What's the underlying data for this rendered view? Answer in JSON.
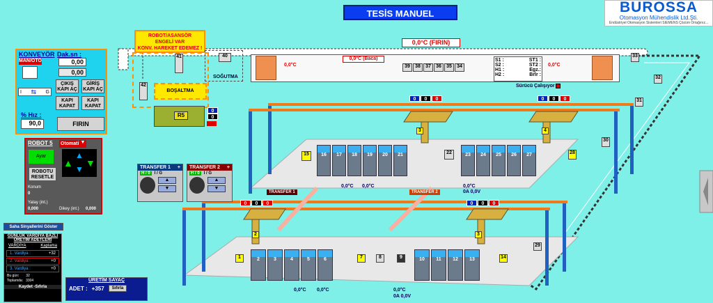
{
  "header": {
    "title": "TESİS MANUEL"
  },
  "logo": {
    "name": "BUROSSA",
    "subtitle": "Otomasyon Mühendislik Ltd.Şti.",
    "tagline": "Endüstriyel Otomasyon Sistemleri SIEMENS Çözüm Ortağınız..."
  },
  "konveyor": {
    "title": "KONVEYÖR",
    "mode_btn": "MAN/OTO",
    "dak_label": "Dak.sn :",
    "dak_val1": "0,00",
    "dak_val2": "0,00",
    "cikis_kapi_ac": "ÇIKIŞ KAPI AÇ",
    "giris_kapi_ac": "GİRİŞ KAPI AÇ",
    "kapi_kapat1": "KAPI KAPAT",
    "kapi_kapat2": "KAPI KAPAT",
    "speed_label": "% Hız :",
    "speed_val": "90,0",
    "firin_btn": "FIRIN",
    "dir_left": "I",
    "dir_right": "G"
  },
  "robot5": {
    "title": "ROBOT 5",
    "mode": "Otomatik",
    "status": "Ayar",
    "reset_btn": "ROBOTU RESETLE",
    "konum_label": "Konum",
    "konum_val": "0",
    "yatay_label": "Yatay (int.)",
    "yatay_val": "0,000",
    "dikey_label": "Dikey (int.)",
    "dikey_val": "0,000"
  },
  "saha_btn": "Saha Sinyallerini Göster",
  "gunluk": {
    "title1": "GÜNLÜK VARDİYA BAZLI",
    "title2": "ÜRETİM ADETLERİ",
    "col1": "VARDİYA",
    "col2": "Kaplama",
    "rows": [
      {
        "name": "1. Vardiya :",
        "val": "+32"
      },
      {
        "name": "2. Vardiya :",
        "val": "+0"
      },
      {
        "name": "3. Vardiya :",
        "val": "+0"
      }
    ],
    "bu_gun_label": "Bu gün:",
    "bu_gun_val": "32",
    "toplam_label": "Toplamda:",
    "toplam_val": "3304",
    "kaydet_btn": "Kaydet -Sıfırla"
  },
  "uretim": {
    "title": "ÜRETİM SAYAÇ",
    "adet_label": "ADET :",
    "adet_val": "+357",
    "sifirla_btn": "Sıfırla"
  },
  "warning": {
    "line1": "ROBOT/ASANSÖR",
    "line2": "ENGELİ VAR",
    "line3": "KONV. HAREKET EDEMEZ !"
  },
  "oven": {
    "firin_label": "0,0°C (FIRIN)",
    "baca_label": "0,0°C (Baca)",
    "left_temp": "0,0°C",
    "right_temp": "0,0°C",
    "mid_temp": "0,0°C",
    "cells": [
      "39",
      "38",
      "37",
      "36",
      "35",
      "34"
    ],
    "s_labels": [
      "S1 :",
      "S2 :",
      "H1 :",
      "H2 :"
    ],
    "st_labels": [
      "ST1 :",
      "ST2 :",
      "Egz.:",
      "Brlr :"
    ],
    "surucu": "Sürücü Çalışıyor :"
  },
  "labels": {
    "bosaltma": "BOŞALTMA",
    "sogutma": "SOĞUTMA",
    "r5": "R5",
    "n40": "40",
    "n41": "41",
    "n42": "42",
    "n33": "33",
    "n32": "32",
    "n31": "31",
    "n30": "30",
    "n29": "29",
    "n28": "28",
    "n22": "22",
    "n15": "15",
    "n14": "14",
    "n9": "9",
    "n8": "8",
    "n7": "7",
    "n1": "1",
    "n3u": "3",
    "n4u": "4",
    "n2l": "2",
    "n3l": "3"
  },
  "upper_tanks": [
    "16",
    "17",
    "18",
    "19",
    "20",
    "21",
    "23",
    "24",
    "25",
    "26",
    "27"
  ],
  "lower_tanks": [
    "2",
    "3",
    "4",
    "5",
    "6",
    "10",
    "11",
    "12",
    "13"
  ],
  "transfer1": {
    "title": "TRANSFER 1",
    "hm": "H / 0",
    "ig": "I / G"
  },
  "transfer2": {
    "title": "TRANSFER 2",
    "hm": "H / 0",
    "ig": "I / G"
  },
  "transfer_tags": {
    "t1": "TRANSFER 1",
    "t2": "TRANSFER 2"
  },
  "readings": {
    "u1": "0,0°C",
    "u2": "0,0°C",
    "u3": "0,0°C",
    "u4": "0A  0,0V",
    "l1": "0,0°C",
    "l2": "0,0°C",
    "l3": "0,0°C",
    "l4": "0A  0,0V"
  },
  "badges": {
    "r5": [
      "0",
      "0"
    ],
    "top_upper": [
      "0",
      "0",
      "0"
    ],
    "top_upper2": [
      "0",
      "0",
      "0"
    ],
    "top_lower": [
      "0",
      "0",
      "0"
    ],
    "top_lower2": [
      "0",
      "0",
      "0"
    ]
  },
  "colors": {
    "bg": "#7ff0e8",
    "accent": "#0a3cf0",
    "warn": "#ff9000",
    "rail": "#f07a1a",
    "pillar": "#2060c0"
  }
}
